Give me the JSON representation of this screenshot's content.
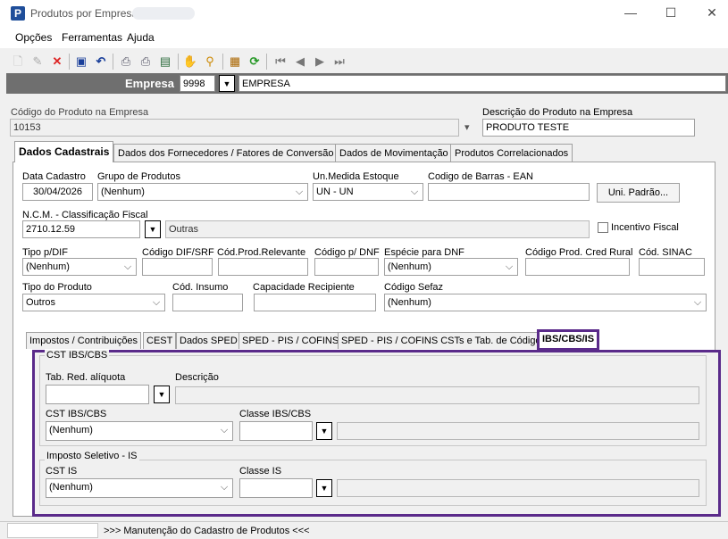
{
  "window": {
    "title": "Produtos por Empresa",
    "minimize": "—",
    "maximize": "☐",
    "close": "✕"
  },
  "menu": {
    "items": [
      "Opções",
      "Ferramentas",
      "Ajuda"
    ]
  },
  "empresa": {
    "label": "Empresa",
    "code": "9998",
    "name": "EMPRESA"
  },
  "produto": {
    "codigo_label": "Código do Produto na Empresa",
    "codigo_value": "10153",
    "descricao_label": "Descrição do Produto na Empresa",
    "descricao_value": "PRODUTO TESTE"
  },
  "tabs": [
    "Dados Cadastrais",
    "Dados dos Fornecedores / Fatores de Conversão",
    "Dados de Movimentação",
    "Produtos Correlacionados"
  ],
  "cadastro": {
    "data_label": "Data Cadastro",
    "data_value": "30/04/2026",
    "grupo_label": "Grupo de Produtos",
    "grupo_value": "(Nenhum)",
    "unmed_label": "Un.Medida Estoque",
    "unmed_value": "UN - UN",
    "ean_label": "Codigo de Barras - EAN",
    "ean_value": "",
    "uni_button": "Uni. Padrão...",
    "ncm_label": "N.C.M. -  Classificação Fiscal",
    "ncm_value": "2710.12.59",
    "ncm_desc": "Outras",
    "incentivo_label": "Incentivo Fiscal",
    "tipodif_label": "Tipo p/DIF",
    "tipodif_value": "(Nenhum)",
    "coddif_label": "Código DIF/SRF",
    "codrel_label": "Cód.Prod.Relevante",
    "coddnf_label": "Código p/ DNF",
    "especie_label": "Espécie para DNF",
    "especie_value": "(Nenhum)",
    "credrural_label": "Código Prod. Cred Rural",
    "sinac_label": "Cód. SINAC",
    "tipoprod_label": "Tipo do Produto",
    "tipoprod_value": "Outros",
    "insumo_label": "Cód. Insumo",
    "capacidade_label": "Capacidade Recipiente",
    "sefaz_label": "Código Sefaz",
    "sefaz_value": "(Nenhum)"
  },
  "subtabs": [
    "Impostos / Contribuições",
    "CEST",
    "Dados SPED",
    "SPED - PIS / COFINS",
    "SPED - PIS / COFINS CSTs e Tab. de Códigos",
    "IBS/CBS/IS"
  ],
  "ibs": {
    "group1_title": "CST IBS/CBS",
    "tabred_label": "Tab. Red. alíquota",
    "descricao_label": "Descrição",
    "cst_label": "CST IBS/CBS",
    "cst_value": "(Nenhum)",
    "classe_label": "Classe IBS/CBS",
    "group2_title": "Imposto Seletivo - IS",
    "cstis_label": "CST IS",
    "cstis_value": "(Nenhum)",
    "classeis_label": "Classe IS"
  },
  "status": {
    "text": ">>> Manutenção do Cadastro de Produtos <<<"
  }
}
